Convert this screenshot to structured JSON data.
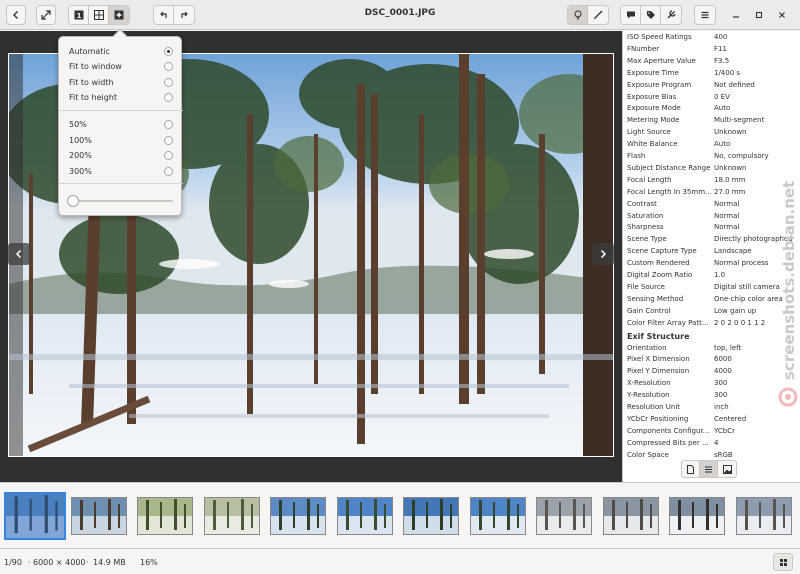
{
  "window": {
    "title": "DSC_0001.JPG"
  },
  "toolbar": {
    "back_icon": "chevron-left-icon",
    "fullscreen_icon": "expand-icon",
    "view_single_icon": "single-view-icon",
    "view_grid_icon": "grid-view-icon",
    "view_zoom_icon": "zoom-view-icon",
    "rotate_left_icon": "rotate-left-icon",
    "rotate_right_icon": "rotate-right-icon",
    "light_icon": "lightbulb-icon",
    "edit_icon": "brush-icon",
    "comment_icon": "comment-icon",
    "tag_icon": "tag-icon",
    "tools_icon": "wrench-icon",
    "menu_icon": "hamburger-menu-icon",
    "minimize_icon": "minimize-icon",
    "maximize_icon": "maximize-icon",
    "close_icon": "close-icon"
  },
  "zoom_popover": {
    "fit_options": [
      {
        "label": "Automatic",
        "checked": true
      },
      {
        "label": "Fit to window",
        "checked": false
      },
      {
        "label": "Fit to width",
        "checked": false
      },
      {
        "label": "Fit to height",
        "checked": false
      }
    ],
    "zoom_levels": [
      {
        "label": "50%",
        "checked": false
      },
      {
        "label": "100%",
        "checked": false
      },
      {
        "label": "200%",
        "checked": false
      },
      {
        "label": "300%",
        "checked": false
      }
    ],
    "slider_value": 0
  },
  "properties": {
    "exif_rows": [
      {
        "key": "ISO Speed Ratings",
        "value": "400"
      },
      {
        "key": "FNumber",
        "value": "F11"
      },
      {
        "key": "Max Aperture Value",
        "value": "F3.5"
      },
      {
        "key": "Exposure Time",
        "value": "1/400 s"
      },
      {
        "key": "Exposure Program",
        "value": "Not defined"
      },
      {
        "key": "Exposure Bias",
        "value": "0 EV"
      },
      {
        "key": "Exposure Mode",
        "value": "Auto"
      },
      {
        "key": "Metering Mode",
        "value": "Multi-segment"
      },
      {
        "key": "Light Source",
        "value": "Unknown"
      },
      {
        "key": "White Balance",
        "value": "Auto"
      },
      {
        "key": "Flash",
        "value": "No, compulsory"
      },
      {
        "key": "Subject Distance Range",
        "value": "Unknown"
      },
      {
        "key": "Focal Length",
        "value": "18.0 mm"
      },
      {
        "key": "Focal Length In 35mm...",
        "value": "27.0 mm"
      },
      {
        "key": "Contrast",
        "value": "Normal"
      },
      {
        "key": "Saturation",
        "value": "Normal"
      },
      {
        "key": "Sharpness",
        "value": "Normal"
      },
      {
        "key": "Scene Type",
        "value": "Directly photographed"
      },
      {
        "key": "Scene Capture Type",
        "value": "Landscape"
      },
      {
        "key": "Custom Rendered",
        "value": "Normal process"
      },
      {
        "key": "Digital Zoom Ratio",
        "value": "1.0"
      },
      {
        "key": "File Source",
        "value": "Digital still camera"
      },
      {
        "key": "Sensing Method",
        "value": "One-chip color area"
      },
      {
        "key": "Gain Control",
        "value": "Low gain up"
      },
      {
        "key": "Color Filter Array Patt...",
        "value": "2 0 2 0 0 1 1 2"
      }
    ],
    "section_title": "Exif Structure",
    "structure_rows": [
      {
        "key": "Orientation",
        "value": "top, left"
      },
      {
        "key": "Pixel X Dimension",
        "value": "6000"
      },
      {
        "key": "Pixel Y Dimension",
        "value": "4000"
      },
      {
        "key": "X-Resolution",
        "value": "300"
      },
      {
        "key": "Y-Resolution",
        "value": "300"
      },
      {
        "key": "Resolution Unit",
        "value": "inch"
      },
      {
        "key": "YCbCr Positioning",
        "value": "Centered"
      },
      {
        "key": "Components Configur...",
        "value": "YCbCr"
      },
      {
        "key": "Compressed Bits per ...",
        "value": "4"
      },
      {
        "key": "Color Space",
        "value": "sRGB"
      }
    ]
  },
  "thumbnails": {
    "count": 12,
    "selected_index": 0
  },
  "status": {
    "position": "1/90",
    "dimensions": "6000 × 4000",
    "size": "14.9 MB",
    "zoom": "16%"
  },
  "watermark": {
    "text": "screenshots.debian.net"
  },
  "colors": {
    "accent": "#3584e4",
    "viewer_bg": "#303030"
  }
}
